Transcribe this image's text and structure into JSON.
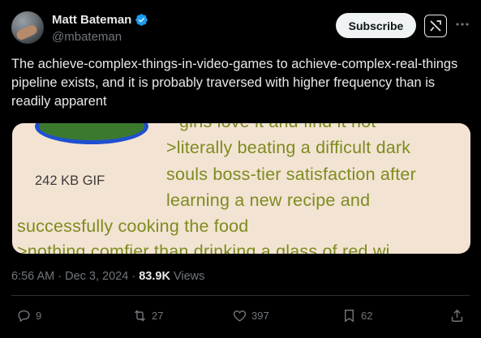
{
  "author": {
    "name": "Matt Bateman",
    "handle": "@mbateman",
    "verified_icon": "verified-badge-icon"
  },
  "header": {
    "subscribe_label": "Subscribe",
    "grok_icon": "grok-icon",
    "more_icon": "more-icon"
  },
  "tweet": {
    "text": "The achieve-complex-things-in-video-games to achieve-complex-real-things pipeline exists, and it is probably traversed with higher frequency than is readily apparent"
  },
  "media": {
    "gif_label": "242 KB GIF",
    "lines": [
      "girls love it and find it hot",
      ">literally beating a difficult dark",
      "souls boss-tier satisfaction after",
      "learning a new recipe and",
      "successfully cooking the food",
      ">nothing comfier than drinking a glass of red wi"
    ],
    "text_color": "#7c8c1e",
    "background_color": "#f3e3d3"
  },
  "meta": {
    "time": "6:56 AM",
    "separator": "·",
    "date": "Dec 3, 2024",
    "views_count": "83.9K",
    "views_label": "Views"
  },
  "actions": {
    "replies": "9",
    "reposts": "27",
    "likes": "397",
    "bookmarks": "62"
  },
  "colors": {
    "background": "#000000",
    "text": "#e7e9ea",
    "muted": "#71767b",
    "verified": "#1d9bf0"
  }
}
